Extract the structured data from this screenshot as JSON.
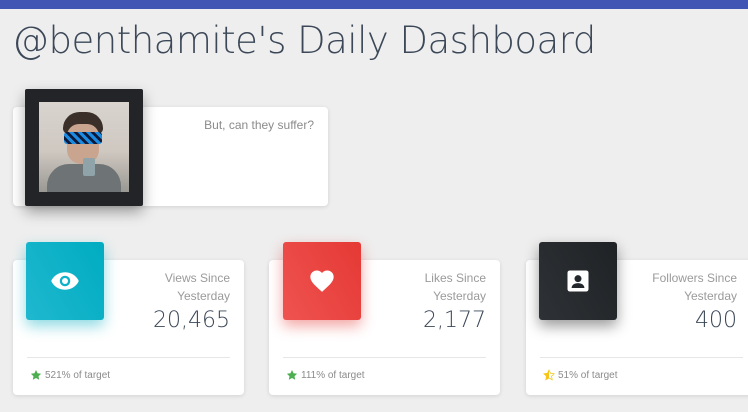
{
  "header": {
    "title": "@benthamite's Daily Dashboard",
    "accent_color": "#4156b4"
  },
  "profile": {
    "tagline": "But, can they suffer?",
    "avatar_icon": "user-photo"
  },
  "stats": [
    {
      "icon": "eye-icon",
      "color": "#1fb8cf",
      "label": "Views Since Yesterday",
      "value": "20,465",
      "footer": "521% of target",
      "footer_icon": "star-filled-icon",
      "footer_icon_color": "#4caf50"
    },
    {
      "icon": "heart-icon",
      "color": "#ef4646",
      "label": "Likes Since Yesterday",
      "value": "2,177",
      "footer": "111% of target",
      "footer_icon": "star-filled-icon",
      "footer_icon_color": "#4caf50"
    },
    {
      "icon": "contact-card-icon",
      "color": "#24272b",
      "label": "Followers Since Yesterday",
      "value": "400",
      "footer": "51% of target",
      "footer_icon": "star-half-icon",
      "footer_icon_color": "#f5c518"
    }
  ]
}
